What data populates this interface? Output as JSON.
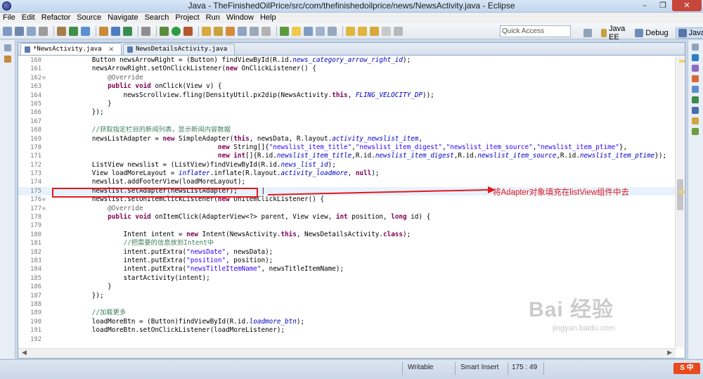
{
  "window": {
    "title": "Java - TheFinishedOilPrice/src/com/thefinishedoilprice/news/NewsActivity.java - Eclipse",
    "controls": [
      "–",
      "❐",
      "✕"
    ]
  },
  "menu": [
    "File",
    "Edit",
    "Refactor",
    "Source",
    "Navigate",
    "Search",
    "Project",
    "Run",
    "Window",
    "Help"
  ],
  "toolbar": {
    "quick_access_placeholder": "Quick Access",
    "perspectives": [
      "Java EE",
      "Debug",
      "Java"
    ]
  },
  "tabs": [
    {
      "label": "*NewsActivity.java",
      "close": "✕",
      "active": true
    },
    {
      "label": "NewsDetailsActivity.java",
      "active": false
    }
  ],
  "code": {
    "lines": [
      {
        "n": "160",
        "fold": "",
        "html": "        Button newsArrowRight = (Button) findViewById(R.id.<span class='fld'>news_category_arrow_right_id</span>);"
      },
      {
        "n": "161",
        "fold": "",
        "html": "        newsArrowRight.setOnClickListener(<span class='kw'>new</span> OnClickListener() {"
      },
      {
        "n": "162",
        "fold": "⊖",
        "html": "            <span class='ann'>@Override</span>"
      },
      {
        "n": "163",
        "fold": "",
        "html": "            <span class='kw'>public</span> <span class='kw'>void</span> onClick(View v) {"
      },
      {
        "n": "164",
        "fold": "",
        "html": "                newsScrollview.fling(DensityUtil.px2dip(NewsActivity.<span class='kw'>this</span>, <span class='fld'>FLING_VELOCITY_DP</span>));"
      },
      {
        "n": "165",
        "fold": "",
        "html": "            }"
      },
      {
        "n": "166",
        "fold": "",
        "html": "        });"
      },
      {
        "n": "167",
        "fold": "",
        "html": ""
      },
      {
        "n": "168",
        "fold": "",
        "html": "        <span class='cmt'>//获取指定栏目的新闻列表，显示新闻内容数据</span>"
      },
      {
        "n": "169",
        "fold": "",
        "html": "        newsListAdapter = <span class='kw'>new</span> SimpleAdapter(<span class='kw'>this</span>, newsData, R.layout.<span class='fld'>activity_newslist_item</span>,"
      },
      {
        "n": "170",
        "fold": "",
        "html": "                                        <span class='kw'>new</span> String[]{<span class='str'>\"newslist_item_title\"</span>,<span class='str'>\"newslist_item_digest\"</span>,<span class='str'>\"newslist_item_source\"</span>,<span class='str'>\"newslist_item_ptime\"</span>},"
      },
      {
        "n": "171",
        "fold": "",
        "html": "                                        <span class='kw'>new</span> <span class='kw'>int</span>[]{R.id.<span class='fld'>newslist_item_title</span>,R.id.<span class='fld'>newslist_item_digest</span>,R.id.<span class='fld'>newslist_item_source</span>,R.id.<span class='fld'>newslist_item_ptime</span>});"
      },
      {
        "n": "172",
        "fold": "",
        "html": "        ListView newslist = (ListView)findViewById(R.id.<span class='fld'>news_list_id</span>);"
      },
      {
        "n": "173",
        "fold": "",
        "html": "        View loadMoreLayout = <span class='fld'>inflater</span>.inflate(R.layout.<span class='fld'>activity_loadmore</span>, <span class='kw'>null</span>);"
      },
      {
        "n": "174",
        "fold": "",
        "html": "        newslist.addFooterView(loadMoreLayout);"
      },
      {
        "n": "175",
        "fold": "",
        "html": "        newslist.setAdapter(newsListAdapter);      |"
      },
      {
        "n": "176",
        "fold": "⊖",
        "html": "        newslist.setOnItemClickListener(<span class='kw'>new</span> OnItemClickListener() {"
      },
      {
        "n": "177",
        "fold": "⊖",
        "html": "            <span class='ann'>@Override</span>"
      },
      {
        "n": "178",
        "fold": "",
        "html": "            <span class='kw'>public</span> <span class='kw'>void</span> onItemClick(AdapterView&lt;?&gt; parent, View view, <span class='kw'>int</span> position, <span class='kw'>long</span> id) {"
      },
      {
        "n": "179",
        "fold": "",
        "html": ""
      },
      {
        "n": "180",
        "fold": "",
        "html": "                Intent intent = <span class='kw'>new</span> Intent(NewsActivity.<span class='kw'>this</span>, NewsDetailsActivity.<span class='kw'>class</span>);"
      },
      {
        "n": "181",
        "fold": "",
        "html": "                <span class='cmt'>//把需要的信息放到Intent中</span>"
      },
      {
        "n": "182",
        "fold": "",
        "html": "                intent.putExtra(<span class='str'>\"newsDate\"</span>, newsData);"
      },
      {
        "n": "183",
        "fold": "",
        "html": "                intent.putExtra(<span class='str'>\"position\"</span>, position);"
      },
      {
        "n": "184",
        "fold": "",
        "html": "                intent.putExtra(<span class='str'>\"newsTitleItemName\"</span>, newsTitleItemName);"
      },
      {
        "n": "185",
        "fold": "",
        "html": "                startActivity(intent);"
      },
      {
        "n": "186",
        "fold": "",
        "html": "            }"
      },
      {
        "n": "187",
        "fold": "",
        "html": "        });"
      },
      {
        "n": "188",
        "fold": "",
        "html": ""
      },
      {
        "n": "189",
        "fold": "",
        "html": "        <span class='cmt'>//加载更多</span>"
      },
      {
        "n": "190",
        "fold": "",
        "html": "        loadMoreBtn = (Button)findViewById(R.id.<span class='fld'>loadmore_btn</span>);"
      },
      {
        "n": "191",
        "fold": "",
        "html": "        loadMoreBtn.setOnClickListener(loadMoreListener);"
      },
      {
        "n": "192",
        "fold": "",
        "html": ""
      }
    ],
    "current_line": "175"
  },
  "annotation": {
    "text": "将Adapter对象填充在listView组件中去",
    "color": "#e31a1c"
  },
  "status": {
    "mode": "Writable",
    "insert": "Smart Insert",
    "position": "175 : 49"
  },
  "watermark": {
    "brand": "Bai 经验",
    "url": "jingyan.baidu.com"
  },
  "tray_badge": "S 中"
}
